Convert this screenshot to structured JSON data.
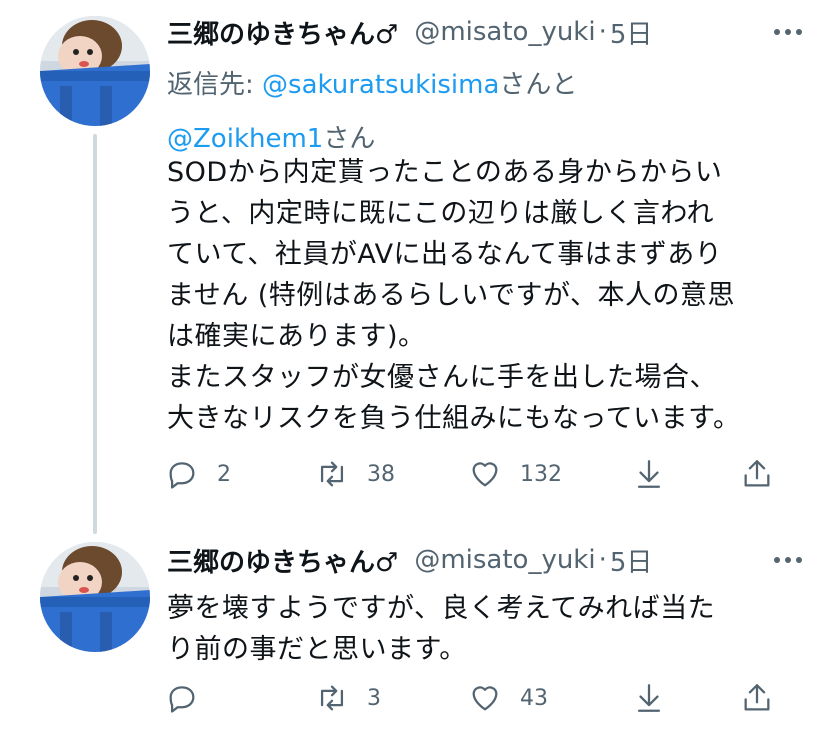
{
  "tweets": [
    {
      "name": "三郷のゆきちゃん♂",
      "handle": "@misato_yuki",
      "separator": "·",
      "time": "5日",
      "reply_label": "返信先:",
      "reply_mentions": [
        "@sakuratsukisima",
        "@Zoikhem1"
      ],
      "reply_suffixes": [
        "さんと",
        "さん"
      ],
      "body_lines": [
        "SODから内定貰ったことのある身からからい",
        "うと、内定時に既にこの辺りは厳しく言われ",
        "ていて、社員がAVに出るなんて事はまずあり",
        "ません (特例はあるらしいですが、本人の意思",
        "は確実にあります)。",
        "またスタッフが女優さんに手を出した場合、",
        "大きなリスクを負う仕組みにもなっています。"
      ],
      "replies": "2",
      "retweets": "38",
      "likes": "132"
    },
    {
      "name": "三郷のゆきちゃん♂",
      "handle": "@misato_yuki",
      "separator": "·",
      "time": "5日",
      "body_lines": [
        "夢を壊すようですが、良く考えてみれば当た",
        "り前の事だと思います。"
      ],
      "replies": "",
      "retweets": "3",
      "likes": "43"
    }
  ],
  "icons": {
    "reply": "reply-icon",
    "retweet": "retweet-icon",
    "like": "heart-icon",
    "bookmark": "bookmark-download-icon",
    "share": "share-icon",
    "more": "more-horizontal-icon"
  },
  "colors": {
    "text": "#0f1419",
    "secondary": "#536471",
    "link": "#1d9bf0",
    "thread_line": "#cfd9de"
  }
}
